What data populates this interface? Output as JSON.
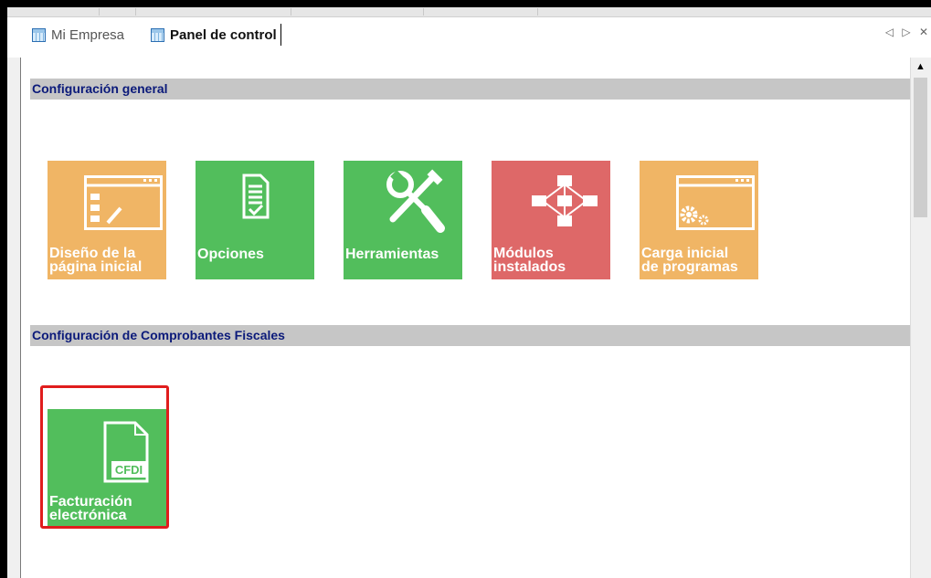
{
  "tabs": [
    {
      "label": "Mi Empresa",
      "active": false
    },
    {
      "label": "Panel de control",
      "active": true
    }
  ],
  "tab_controls": "◁ ▷ ✕",
  "sections": [
    {
      "title": "Configuración general",
      "tiles": [
        {
          "label_line1": "Diseño de la",
          "label_line2": "página inicial",
          "color": "#f0b565",
          "icon": "window-edit-icon"
        },
        {
          "label_line1": "Opciones",
          "label_line2": "",
          "color": "#52be5c",
          "icon": "checklist-icon"
        },
        {
          "label_line1": "Herramientas",
          "label_line2": "",
          "color": "#52be5c",
          "icon": "tools-icon"
        },
        {
          "label_line1": "Módulos",
          "label_line2": "instalados",
          "color": "#de6868",
          "icon": "modules-icon"
        },
        {
          "label_line1": "Carga inicial",
          "label_line2": "de programas",
          "color": "#f0b565",
          "icon": "window-gears-icon"
        }
      ]
    },
    {
      "title": "Configuración de Comprobantes Fiscales",
      "tiles": [
        {
          "label_line1": "Facturación",
          "label_line2": "electrónica",
          "color": "#52be5c",
          "icon": "cfdi-document-icon",
          "icon_text": "CFDI"
        }
      ]
    }
  ],
  "colors": {
    "section_header_bg": "#c6c6c6",
    "section_header_text": "#0b1a7a",
    "highlight_border": "#e01d1d"
  }
}
